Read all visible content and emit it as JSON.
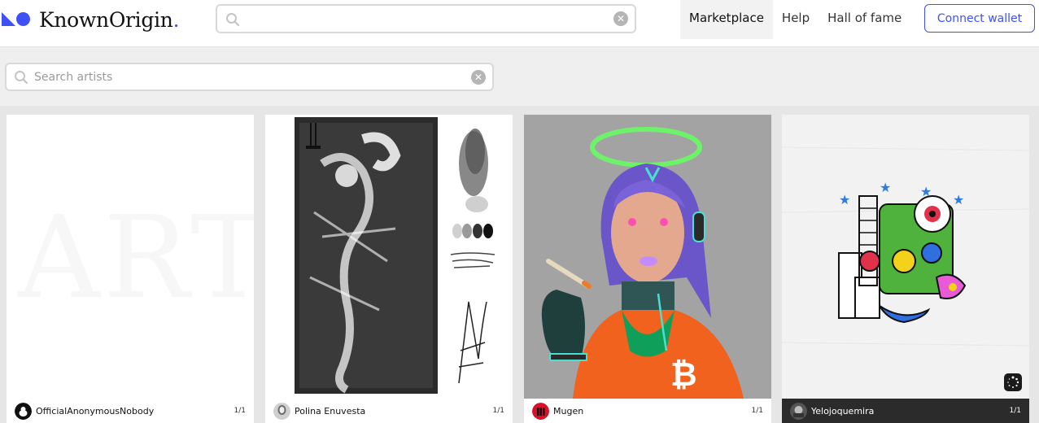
{
  "header": {
    "logo_text": "KnownOrigin",
    "logo_period": ".",
    "search": {
      "value": "",
      "placeholder": ""
    },
    "nav": [
      {
        "label": "Marketplace",
        "active": true
      },
      {
        "label": "Help",
        "active": false
      },
      {
        "label": "Hall of fame",
        "active": false
      }
    ],
    "connect_label": "Connect wallet"
  },
  "artist_search": {
    "value": "",
    "placeholder": "Search artists"
  },
  "cards": [
    {
      "artist": "OfficialAnonymousNobody",
      "edition": "1/1",
      "ghost_text": "ART"
    },
    {
      "artist": "Polina Enuvesta",
      "edition": "1/1"
    },
    {
      "artist": "Mugen",
      "edition": "1/1"
    },
    {
      "artist": "Yelojoquemira",
      "edition": "1/1"
    }
  ],
  "colors": {
    "accent": "#3f51f5",
    "page_bg": "#efefef"
  }
}
